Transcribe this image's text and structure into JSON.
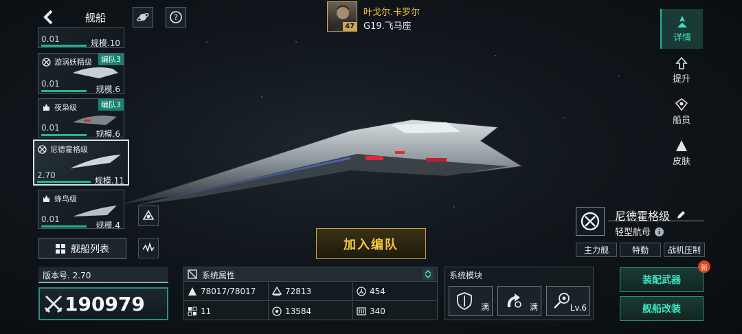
{
  "header": {
    "title": "舰船",
    "icons": {
      "back": "back-arrow-icon",
      "planet": "planet-icon",
      "help": "help-icon"
    }
  },
  "player": {
    "name": "叶戈尔.卡罗尔",
    "location": "G19.飞马座",
    "level": "47"
  },
  "ship_list": [
    {
      "name": "",
      "power": "0.01",
      "scale": "规模.10",
      "badge": "",
      "icon": "ship-type-icon",
      "bar": 0.6,
      "selected": false
    },
    {
      "name": "漩涡妖精级",
      "power": "0.01",
      "scale": "规模.6",
      "badge": "编队3",
      "icon": "crosshair-icon",
      "bar": 0.6,
      "selected": false
    },
    {
      "name": "夜枭级",
      "power": "0.01",
      "scale": "规模.6",
      "badge": "编队3",
      "icon": "flame-icon",
      "bar": 0.6,
      "selected": false
    },
    {
      "name": "尼德霍格级",
      "power": "2.70",
      "scale": "规模.11",
      "badge": "",
      "icon": "crosshair-icon",
      "bar": 0.6,
      "selected": true
    },
    {
      "name": "蜂鸟级",
      "power": "0.01",
      "scale": "规模.4",
      "badge": "",
      "icon": "flame-icon",
      "bar": 0.6,
      "selected": false
    }
  ],
  "fleet_list_button": "舰船列表",
  "version": "版本号. 2.70",
  "combat_power": "190979",
  "join_fleet_button": "加入编队",
  "system_attributes": {
    "title": "系统属性",
    "cells": [
      {
        "icon": "hull-icon",
        "value": "78017/78017"
      },
      {
        "icon": "armor-icon",
        "value": "72813"
      },
      {
        "icon": "shield-icon",
        "value": "454"
      },
      {
        "icon": "grid-icon",
        "value": "11"
      },
      {
        "icon": "target-icon",
        "value": "13584"
      },
      {
        "icon": "speed-icon",
        "value": "340"
      }
    ]
  },
  "system_modules": {
    "title": "系统模块",
    "slots": [
      {
        "icon": "shield-module-icon",
        "label": "满"
      },
      {
        "icon": "repair-module-icon",
        "label": "满"
      },
      {
        "icon": "weapon-module-icon",
        "label": "Lv.6"
      }
    ]
  },
  "right_nav": [
    {
      "label": "详情",
      "icon": "details-icon",
      "active": true
    },
    {
      "label": "提升",
      "icon": "upgrade-icon",
      "active": false
    },
    {
      "label": "船员",
      "icon": "crew-icon",
      "active": false
    },
    {
      "label": "皮肤",
      "icon": "skin-icon",
      "active": false
    }
  ],
  "ship_info": {
    "name": "尼德霍格级",
    "class": "轻型航母",
    "tags": [
      "主力舰",
      "特勤",
      "战机压制"
    ]
  },
  "actions": {
    "equip_weapons": "装配武器",
    "ship_modify": "舰船改装",
    "new_badge": "新"
  },
  "colors": {
    "accent": "#20b79a",
    "gold": "#f4c93c",
    "badge_red": "#e0431c"
  }
}
